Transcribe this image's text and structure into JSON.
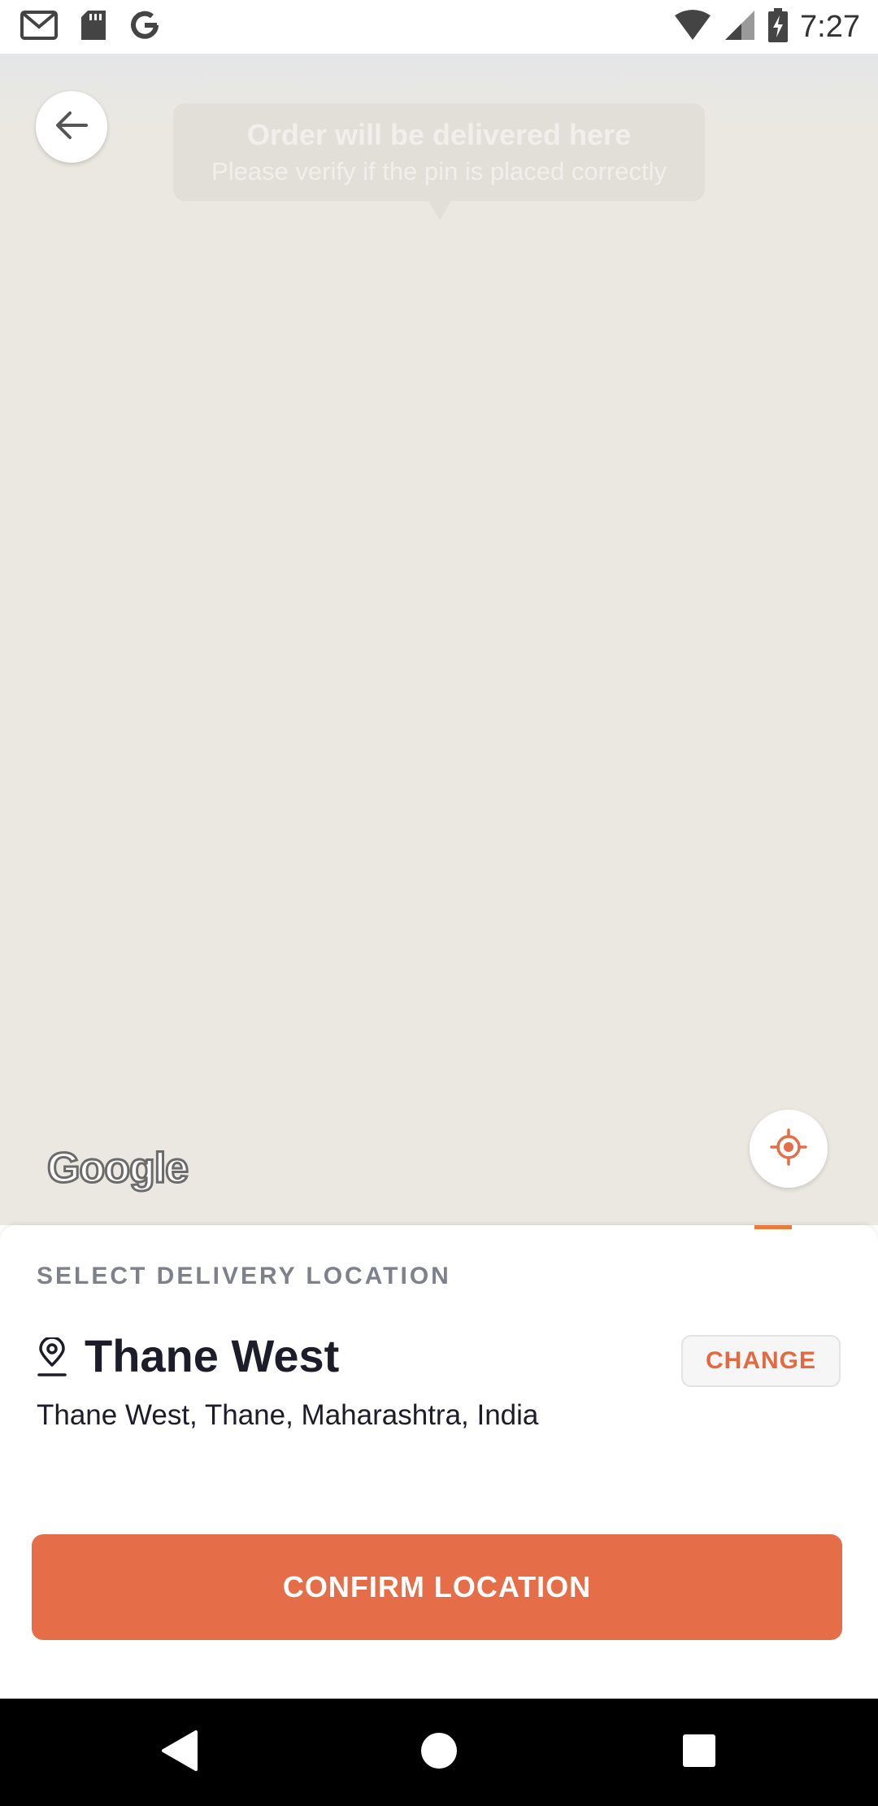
{
  "status_bar": {
    "time": "7:27",
    "left_icons": [
      "gmail-icon",
      "sd-card-icon",
      "google-icon"
    ],
    "right_icons": [
      "wifi-icon",
      "signal-icon",
      "battery-charging-icon"
    ]
  },
  "map": {
    "tooltip_title": "Order will be delivered here",
    "tooltip_subtitle": "Please verify if the pin is placed correctly",
    "attribution": "Google",
    "back_icon": "arrow-left-icon",
    "locate_icon": "crosshair-icon"
  },
  "sheet": {
    "heading": "SELECT DELIVERY LOCATION",
    "location_title": "Thane West",
    "location_address": "Thane West, Thane, Maharashtra, India",
    "change_label": "CHANGE",
    "confirm_label": "CONFIRM LOCATION"
  },
  "colors": {
    "accent": "#e56d48",
    "map_background": "#ebe8e1",
    "heading_gray": "#7e808c"
  },
  "nav_bar": {
    "buttons": [
      "back-triangle-icon",
      "home-circle-icon",
      "recents-square-icon"
    ]
  }
}
